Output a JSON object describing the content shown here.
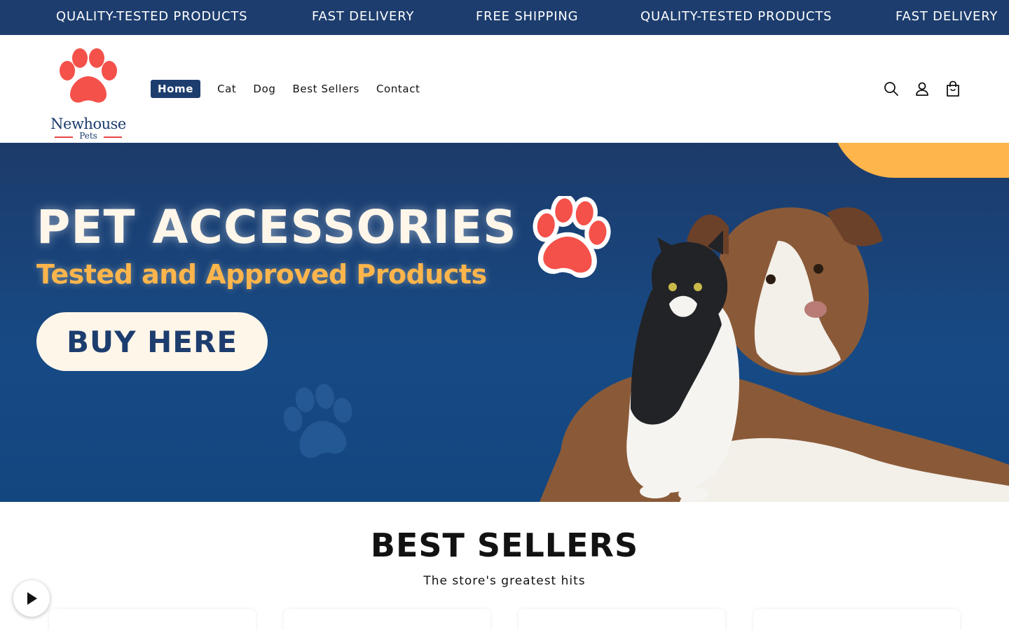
{
  "announcement": {
    "items": [
      "QUALITY-TESTED PRODUCTS",
      "FAST DELIVERY",
      "FREE SHIPPING",
      "QUALITY-TESTED PRODUCTS",
      "FAST DELIVERY"
    ]
  },
  "header": {
    "logo": {
      "name": "Newhouse",
      "sub": "Pets"
    },
    "nav": [
      "Home",
      "Cat",
      "Dog",
      "Best Sellers",
      "Contact"
    ],
    "active_nav": "Home",
    "icons": [
      "search-icon",
      "account-icon",
      "cart-icon"
    ]
  },
  "hero": {
    "title": "PET ACCESSORIES",
    "subtitle": "Tested and Approved Products",
    "button": "BUY HERE"
  },
  "best_sellers": {
    "title": "BEST SELLERS",
    "subtitle": "The store's greatest hits"
  },
  "colors": {
    "brand_navy": "#1d3d6e",
    "accent_orange": "#fdb54c",
    "paw_red": "#f4514a",
    "cream": "#fff6ea"
  }
}
